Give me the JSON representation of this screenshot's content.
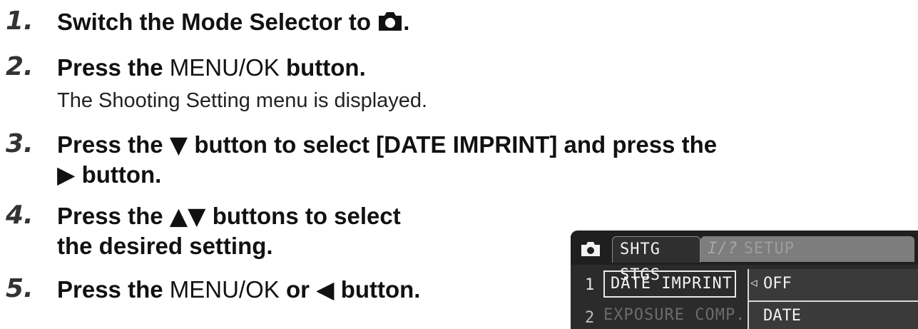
{
  "steps": [
    {
      "number": "1.",
      "pre": "Switch the Mode Selector to",
      "post": ".",
      "icon": "camera-icon"
    },
    {
      "number": "2.",
      "pre": "Press the",
      "plain": "MENU/OK",
      "post": "button.",
      "note": "The Shooting Setting menu is displayed."
    },
    {
      "number": "3.",
      "line1_pre": "Press the",
      "line1_glyph": "▼",
      "line1_post": "button to select [DATE IMPRINT] and press the",
      "line2_glyph": "▶",
      "line2_post": "button."
    },
    {
      "number": "4.",
      "line1_pre": "Press the",
      "line1_glyph": "▲▼",
      "line1_post": "buttons to select",
      "line2": "the desired setting."
    },
    {
      "number": "5.",
      "pre": "Press the",
      "plain": "MENU/OK",
      "mid": "or",
      "glyph": "◀",
      "post": "button."
    }
  ],
  "lcd": {
    "tab_active": "SHTG STGS",
    "tab_inactive_glyph": "I/?",
    "tab_inactive": "SETUP",
    "rows": [
      {
        "number": "1",
        "label": "DATE IMPRINT"
      },
      {
        "number": "2",
        "label": "EXPOSURE COMP."
      }
    ],
    "options": [
      "OFF",
      "DATE"
    ],
    "option_arrow": "◁"
  },
  "colors": {
    "text": "#111111",
    "step_number": "#333333",
    "lcd_background": "#2b2b2b",
    "lcd_text": "#f2f2f2"
  }
}
